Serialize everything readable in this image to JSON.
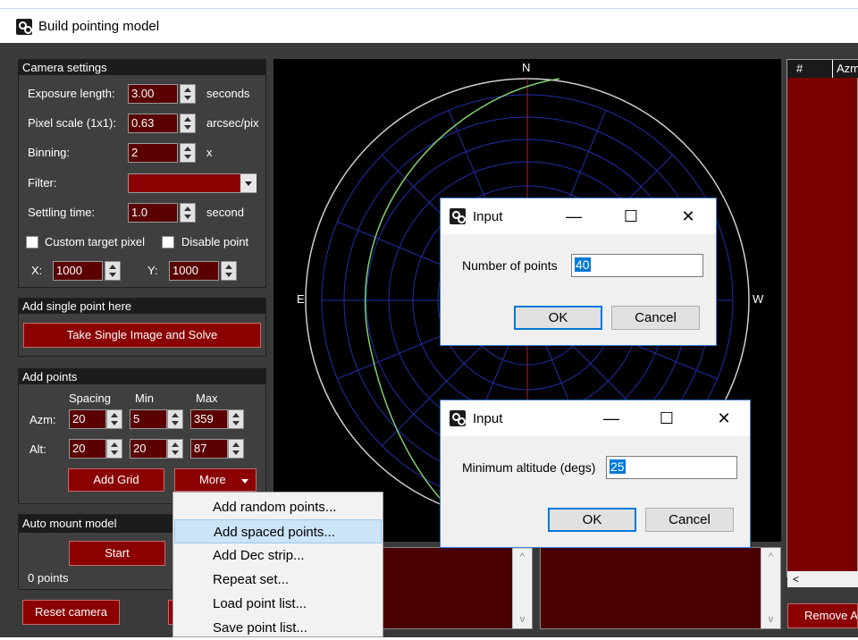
{
  "window": {
    "title": "Build pointing model"
  },
  "camera_settings": {
    "header": "Camera settings",
    "exposure_label": "Exposure length:",
    "exposure_value": "3.00",
    "exposure_unit": "seconds",
    "pixel_scale_label": "Pixel scale (1x1):",
    "pixel_scale_value": "0.63",
    "pixel_scale_unit": "arcsec/pix",
    "binning_label": "Binning:",
    "binning_value": "2",
    "binning_unit": "x",
    "filter_label": "Filter:",
    "filter_value": "",
    "settling_label": "Settling time:",
    "settling_value": "1.0",
    "settling_unit": "second",
    "custom_target_label": "Custom target pixel",
    "disable_point_label": "Disable point",
    "x_label": "X:",
    "x_value": "1000",
    "y_label": "Y:",
    "y_value": "1000"
  },
  "single_point": {
    "header": "Add single point here",
    "button": "Take Single Image and Solve"
  },
  "add_points": {
    "header": "Add points",
    "col_spacing": "Spacing",
    "col_min": "Min",
    "col_max": "Max",
    "azm_label": "Azm:",
    "azm_spacing": "20",
    "azm_min": "5",
    "azm_max": "359",
    "alt_label": "Alt:",
    "alt_spacing": "20",
    "alt_min": "20",
    "alt_max": "87",
    "add_grid": "Add Grid",
    "more": "More"
  },
  "auto_model": {
    "header": "Auto mount model",
    "start": "Start",
    "status": "0 points"
  },
  "reset_camera": "Reset camera",
  "skymap": {
    "n": "N",
    "e": "E",
    "w": "W"
  },
  "point_list": {
    "col_hash": "#",
    "col_azm": "Azm",
    "remove_button": "Remove A",
    "scroll_left": "<"
  },
  "dialog_points": {
    "title": "Input",
    "label": "Number of points",
    "value": "40",
    "ok": "OK",
    "cancel": "Cancel"
  },
  "dialog_altitude": {
    "title": "Input",
    "label": "Minimum altitude (degs)",
    "value": "25",
    "ok": "OK",
    "cancel": "Cancel"
  },
  "window_controls": {
    "minimize": "—",
    "maximize": "☐",
    "close": "✕"
  },
  "more_menu": [
    "Add random points...",
    "Add spaced points...",
    "Add Dec strip...",
    "Repeat set...",
    "Load point list...",
    "Save point list..."
  ],
  "colors": {
    "panel_red": "#8b0000",
    "field_red": "#5a0000",
    "grid_blue": "#1f2fa8",
    "track_green": "#7fcf6f",
    "highlight": "#cce4f7"
  }
}
